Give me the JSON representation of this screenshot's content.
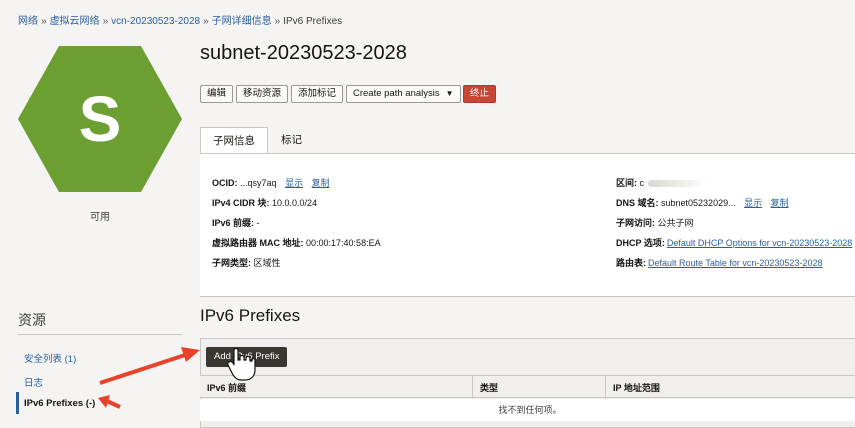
{
  "breadcrumb": {
    "items": [
      "网络",
      "虚拟云网络",
      "vcn-20230523-2028",
      "子网详细信息"
    ],
    "current": "IPv6 Prefixes",
    "separator": "»"
  },
  "resource": {
    "letter": "S",
    "status": "可用",
    "title": "subnet-20230523-2028",
    "hex_color": "#6b9f32"
  },
  "toolbar": {
    "edit": "编辑",
    "move": "移动资源",
    "tag": "添加标记",
    "path_analysis": "Create path analysis",
    "terminate": "终止"
  },
  "tabs": {
    "info": "子网信息",
    "tags": "标记"
  },
  "details": {
    "ocid_label": "OCID:",
    "ocid_value": "...qsy7aq",
    "show": "显示",
    "copy": "复制",
    "ipv4_label": "IPv4 CIDR 块:",
    "ipv4_value": "10.0.0.0/24",
    "ipv6_label": "IPv6 前缀:",
    "ipv6_value": "-",
    "mac_label": "虚拟路由器 MAC 地址:",
    "mac_value": "00:00:17:40:58:EA",
    "type_label": "子网类型:",
    "type_value": "区域性",
    "region_label": "区间:",
    "region_value": "c",
    "dns_label": "DNS 域名:",
    "dns_value": "subnet05232029...",
    "access_label": "子网访问:",
    "access_value": "公共子网",
    "dhcp_label": "DHCP 选项:",
    "dhcp_value": "Default DHCP Options for vcn-20230523-2028",
    "route_label": "路由表:",
    "route_value": "Default Route Table for vcn-20230523-2028"
  },
  "resources": {
    "title": "资源",
    "items": [
      "安全列表 (1)",
      "日志",
      "IPv6 Prefixes (-)"
    ]
  },
  "prefixes": {
    "title": "IPv6 Prefixes",
    "add_button": "Add IPv6 Prefix",
    "columns": [
      "IPv6 前缀",
      "类型",
      "IP 地址范围"
    ],
    "empty": "找不到任何项。"
  },
  "colors": {
    "link": "#2a5f9e",
    "danger": "#c74634",
    "annotation": "#e8412c"
  }
}
